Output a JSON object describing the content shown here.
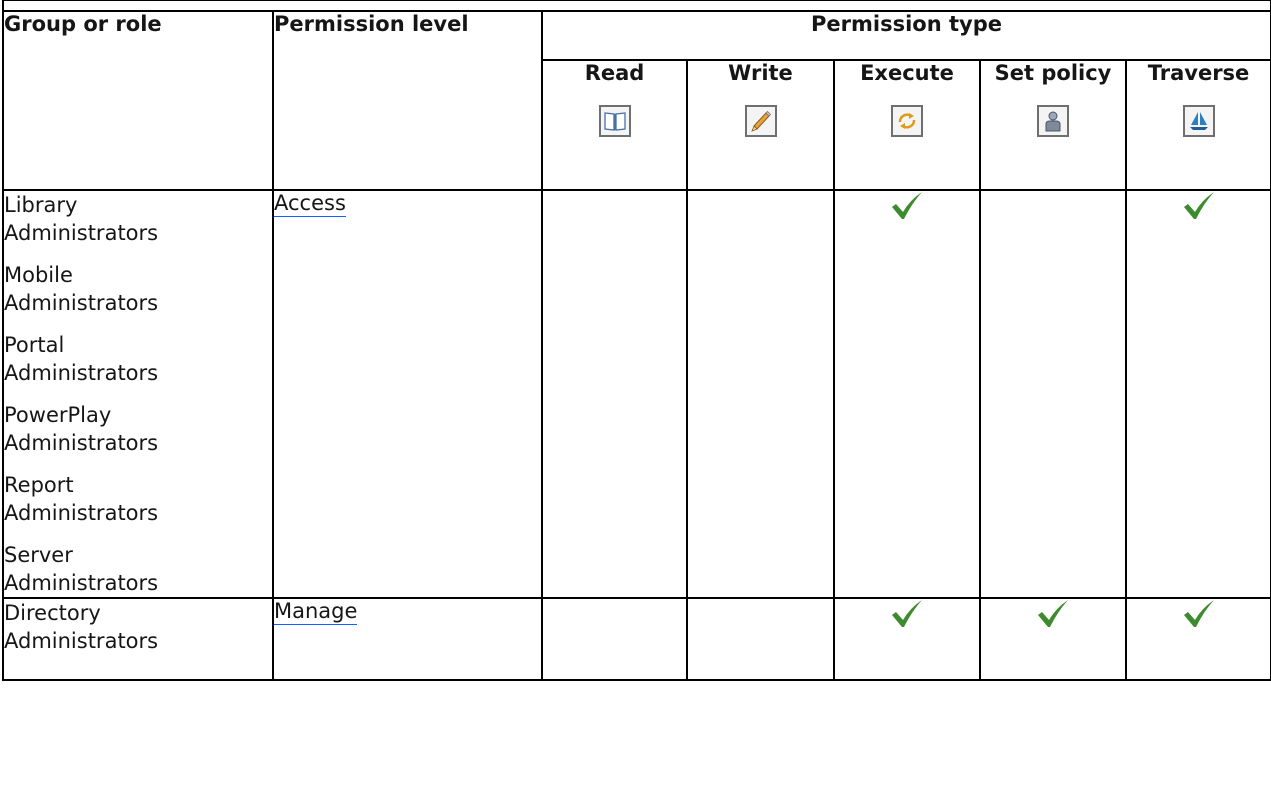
{
  "columns": {
    "group_or_role": "Group or role",
    "permission_level": "Permission level",
    "permission_type": "Permission type",
    "types": [
      {
        "label": "Read",
        "icon": "book-icon"
      },
      {
        "label": "Write",
        "icon": "pencil-icon"
      },
      {
        "label": "Execute",
        "icon": "execute-arrows-icon"
      },
      {
        "label": "Set policy",
        "icon": "person-policy-icon"
      },
      {
        "label": "Traverse",
        "icon": "sailboat-traverse-icon"
      }
    ]
  },
  "rows": [
    {
      "groups": [
        [
          "Library",
          "Administrators"
        ],
        [
          "Mobile",
          "Administrators"
        ],
        [
          "Portal",
          "Administrators"
        ],
        [
          "PowerPlay",
          "Administrators"
        ],
        [
          "Report",
          "Administrators"
        ],
        [
          "Server",
          "Administrators"
        ]
      ],
      "level": "Access",
      "permissions": {
        "read": false,
        "write": false,
        "execute": true,
        "set_policy": false,
        "traverse": true
      }
    },
    {
      "groups": [
        [
          "Directory",
          "Administrators"
        ]
      ],
      "level": "Manage",
      "permissions": {
        "read": false,
        "write": false,
        "execute": true,
        "set_policy": true,
        "traverse": true
      }
    }
  ],
  "colors": {
    "check": "#3e8a2e",
    "link_underline": "#0f62fe",
    "border": "#000000"
  }
}
